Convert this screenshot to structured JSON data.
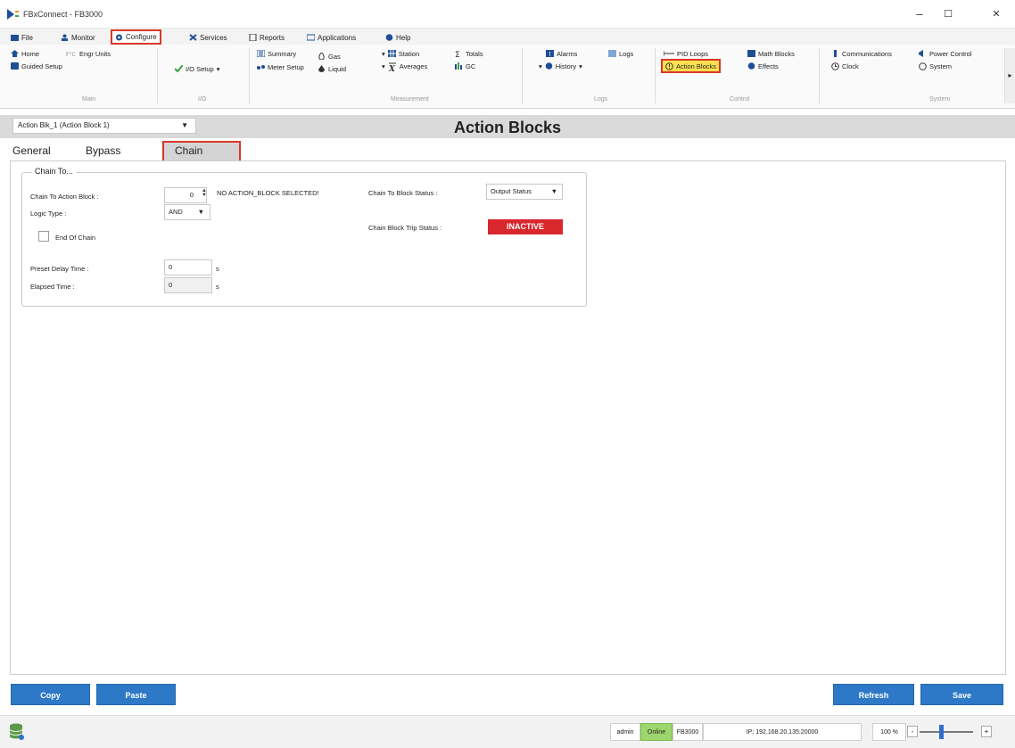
{
  "window": {
    "title": "FBxConnect - FB3000",
    "minimize": "–",
    "maximize": "☐",
    "close": "✕"
  },
  "menu": {
    "file": "File",
    "monitor": "Monitor",
    "configure": "Configure",
    "services": "Services",
    "reports": "Reports",
    "applications": "Applications",
    "help": "Help"
  },
  "ribbon": {
    "main": {
      "home": "Home",
      "engr_units": "Engr Units",
      "guided_setup": "Guided Setup",
      "label": "Main"
    },
    "io": {
      "io_setup": "I/O Setup",
      "label": "I/O"
    },
    "measurement": {
      "summary": "Summary",
      "meter_setup": "Meter Setup",
      "gas": "Gas",
      "liquid": "Liquid",
      "station": "Station",
      "averages": "Averages",
      "totals": "Totals",
      "gc": "GC",
      "label": "Measurement"
    },
    "logs": {
      "alarms": "Alarms",
      "logs": "Logs",
      "history": "History",
      "label": "Logs"
    },
    "control": {
      "pid_loops": "PID Loops",
      "math_blocks": "Math Blocks",
      "action_blocks": "Action Blocks",
      "effects": "Effects",
      "label": "Control"
    },
    "system": {
      "communications": "Communications",
      "power_control": "Power Control",
      "clock": "Clock",
      "system": "System",
      "label": "System"
    }
  },
  "selector": {
    "value": "Action Blk_1 (Action Block 1)"
  },
  "page_title": "Action Blocks",
  "tabs": {
    "general": "General",
    "bypass": "Bypass",
    "chain": "Chain"
  },
  "chain": {
    "group_title": "Chain To...",
    "chain_to_block_label": "Chain To Action Block :",
    "chain_to_block_value": "0",
    "no_selection_msg": "NO ACTION_BLOCK SELECTED!",
    "logic_type_label": "Logic Type :",
    "logic_type_value": "AND",
    "end_of_chain_label": "End Of Chain",
    "preset_delay_label": "Preset Delay Time :",
    "preset_delay_value": "0",
    "elapsed_label": "Elapsed Time :",
    "elapsed_value": "0",
    "unit_s": "s",
    "block_status_label": "Chain To Block Status :",
    "block_status_value": "Output Status",
    "trip_status_label": "Chain Block Trip Status :",
    "trip_status_value": "INACTIVE"
  },
  "buttons": {
    "copy": "Copy",
    "paste": "Paste",
    "refresh": "Refresh",
    "save": "Save"
  },
  "statusbar": {
    "user": "admin",
    "state": "Online",
    "device": "FB3000",
    "ip": "IP: 192.168.20.135:20000",
    "zoom": "100 %"
  }
}
